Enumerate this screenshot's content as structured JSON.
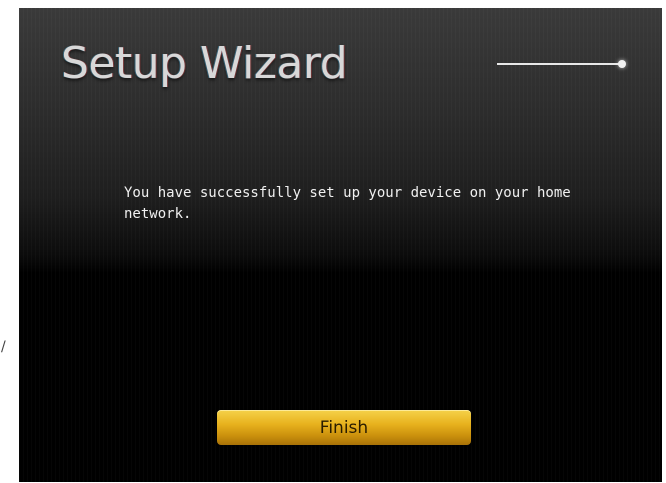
{
  "wizard": {
    "title": "Setup Wizard",
    "message": "You have successfully set up your device on your home network.",
    "finish_label": "Finish",
    "progress": 1.0
  },
  "side_mark": "/",
  "colors": {
    "button_gold": "#e8b21e",
    "background": "#000000",
    "text": "#f0f0f0"
  }
}
